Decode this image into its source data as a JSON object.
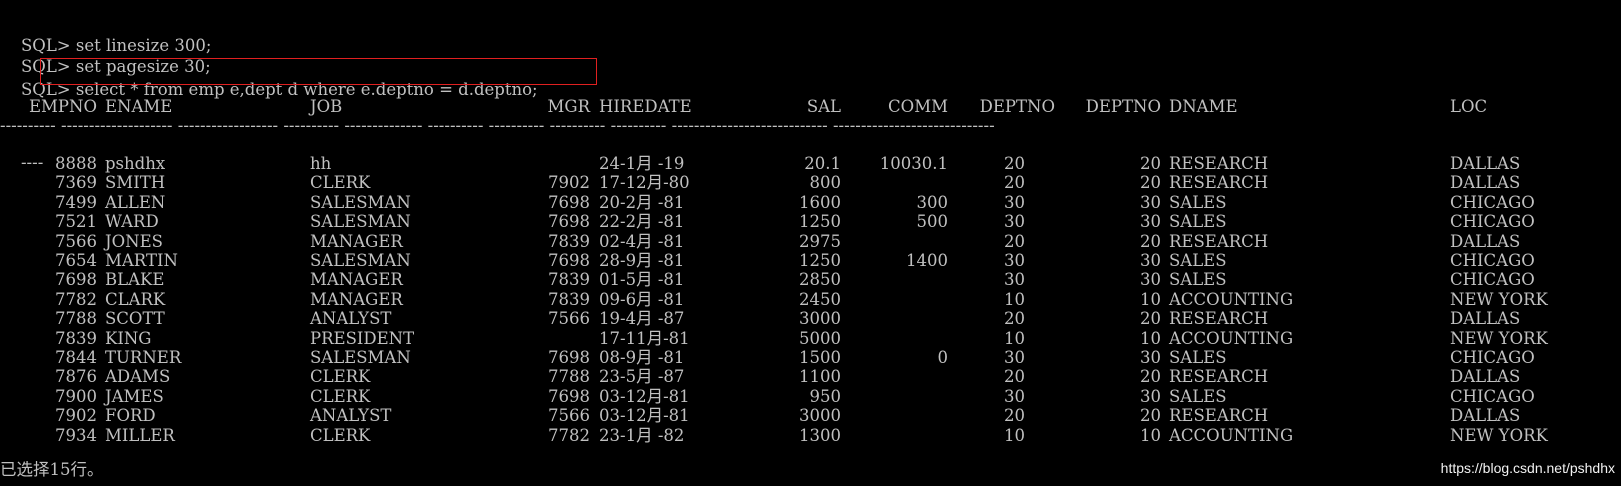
{
  "terminal": {
    "prompt": "SQL>",
    "commands": [
      " set linesize 300;",
      " set pagesize 30;",
      " select * from emp e,dept d where e.deptno = d.deptno;"
    ],
    "highlight_color": "#e02020",
    "text_color": "#c0c0c0",
    "background_color": "#000000"
  },
  "table": {
    "headers": {
      "empno": "EMPNO",
      "ename": "ENAME",
      "job": "JOB",
      "mgr": "MGR",
      "hiredate": "HIREDATE",
      "sal": "SAL",
      "comm": "COMM",
      "deptno": "DEPTNO",
      "deptno2": "DEPTNO",
      "dname": "DNAME",
      "loc": "LOC"
    },
    "separator": "---------- -------------------- ------------------ ---------- -------------- ---------- ---------- ---------- ---------- ---------------------------- -----------------------------",
    "separator_wrap": "----",
    "rows": [
      {
        "empno": "8888",
        "ename": "pshdhx",
        "job": "hh",
        "mgr": "",
        "hiredate": "24-1月 -19",
        "sal": "20.1",
        "comm": "10030.1",
        "deptno": "20",
        "deptno2": "20",
        "dname": "RESEARCH",
        "loc": "DALLAS"
      },
      {
        "empno": "7369",
        "ename": "SMITH",
        "job": "CLERK",
        "mgr": "7902",
        "hiredate": "17-12月-80",
        "sal": "800",
        "comm": "",
        "deptno": "20",
        "deptno2": "20",
        "dname": "RESEARCH",
        "loc": "DALLAS"
      },
      {
        "empno": "7499",
        "ename": "ALLEN",
        "job": "SALESMAN",
        "mgr": "7698",
        "hiredate": "20-2月 -81",
        "sal": "1600",
        "comm": "300",
        "deptno": "30",
        "deptno2": "30",
        "dname": "SALES",
        "loc": "CHICAGO"
      },
      {
        "empno": "7521",
        "ename": "WARD",
        "job": "SALESMAN",
        "mgr": "7698",
        "hiredate": "22-2月 -81",
        "sal": "1250",
        "comm": "500",
        "deptno": "30",
        "deptno2": "30",
        "dname": "SALES",
        "loc": "CHICAGO"
      },
      {
        "empno": "7566",
        "ename": "JONES",
        "job": "MANAGER",
        "mgr": "7839",
        "hiredate": "02-4月 -81",
        "sal": "2975",
        "comm": "",
        "deptno": "20",
        "deptno2": "20",
        "dname": "RESEARCH",
        "loc": "DALLAS"
      },
      {
        "empno": "7654",
        "ename": "MARTIN",
        "job": "SALESMAN",
        "mgr": "7698",
        "hiredate": "28-9月 -81",
        "sal": "1250",
        "comm": "1400",
        "deptno": "30",
        "deptno2": "30",
        "dname": "SALES",
        "loc": "CHICAGO"
      },
      {
        "empno": "7698",
        "ename": "BLAKE",
        "job": "MANAGER",
        "mgr": "7839",
        "hiredate": "01-5月 -81",
        "sal": "2850",
        "comm": "",
        "deptno": "30",
        "deptno2": "30",
        "dname": "SALES",
        "loc": "CHICAGO"
      },
      {
        "empno": "7782",
        "ename": "CLARK",
        "job": "MANAGER",
        "mgr": "7839",
        "hiredate": "09-6月 -81",
        "sal": "2450",
        "comm": "",
        "deptno": "10",
        "deptno2": "10",
        "dname": "ACCOUNTING",
        "loc": "NEW YORK"
      },
      {
        "empno": "7788",
        "ename": "SCOTT",
        "job": "ANALYST",
        "mgr": "7566",
        "hiredate": "19-4月 -87",
        "sal": "3000",
        "comm": "",
        "deptno": "20",
        "deptno2": "20",
        "dname": "RESEARCH",
        "loc": "DALLAS"
      },
      {
        "empno": "7839",
        "ename": "KING",
        "job": "PRESIDENT",
        "mgr": "",
        "hiredate": "17-11月-81",
        "sal": "5000",
        "comm": "",
        "deptno": "10",
        "deptno2": "10",
        "dname": "ACCOUNTING",
        "loc": "NEW YORK"
      },
      {
        "empno": "7844",
        "ename": "TURNER",
        "job": "SALESMAN",
        "mgr": "7698",
        "hiredate": "08-9月 -81",
        "sal": "1500",
        "comm": "0",
        "deptno": "30",
        "deptno2": "30",
        "dname": "SALES",
        "loc": "CHICAGO"
      },
      {
        "empno": "7876",
        "ename": "ADAMS",
        "job": "CLERK",
        "mgr": "7788",
        "hiredate": "23-5月 -87",
        "sal": "1100",
        "comm": "",
        "deptno": "20",
        "deptno2": "20",
        "dname": "RESEARCH",
        "loc": "DALLAS"
      },
      {
        "empno": "7900",
        "ename": "JAMES",
        "job": "CLERK",
        "mgr": "7698",
        "hiredate": "03-12月-81",
        "sal": "950",
        "comm": "",
        "deptno": "30",
        "deptno2": "30",
        "dname": "SALES",
        "loc": "CHICAGO"
      },
      {
        "empno": "7902",
        "ename": "FORD",
        "job": "ANALYST",
        "mgr": "7566",
        "hiredate": "03-12月-81",
        "sal": "3000",
        "comm": "",
        "deptno": "20",
        "deptno2": "20",
        "dname": "RESEARCH",
        "loc": "DALLAS"
      },
      {
        "empno": "7934",
        "ename": "MILLER",
        "job": "CLERK",
        "mgr": "7782",
        "hiredate": "23-1月 -82",
        "sal": "1300",
        "comm": "",
        "deptno": "10",
        "deptno2": "10",
        "dname": "ACCOUNTING",
        "loc": "NEW YORK"
      }
    ]
  },
  "status": {
    "rows_selected": "已选择15行。"
  },
  "watermark": {
    "text": "https://blog.csdn.net/pshdhx"
  }
}
